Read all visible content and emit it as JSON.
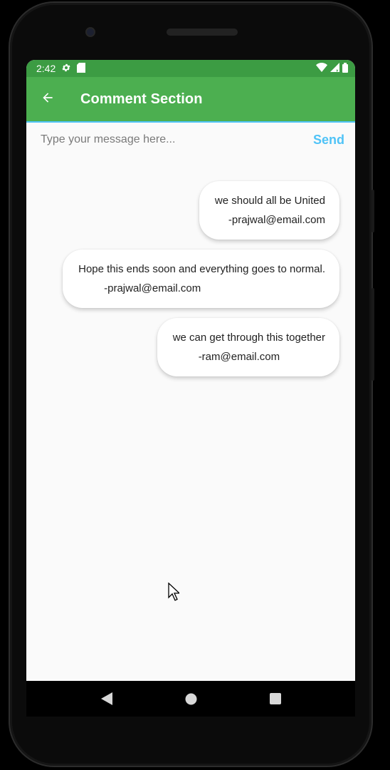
{
  "status_bar": {
    "time": "2:42",
    "icons": [
      "settings-icon",
      "sd-card-icon",
      "wifi-icon",
      "signal-icon",
      "battery-icon"
    ]
  },
  "app_bar": {
    "title": "Comment Section",
    "back_icon": "arrow-back-icon"
  },
  "composer": {
    "placeholder": "Type your message here...",
    "value": "",
    "send_label": "Send"
  },
  "comments": [
    {
      "text": "we should all be United",
      "author": "-prajwal@email.com"
    },
    {
      "text": "Hope this ends soon and everything goes to normal.",
      "author": "-prajwal@email.com"
    },
    {
      "text": "we can get through this together",
      "author": "-ram@email.com"
    }
  ],
  "nav_bar": {
    "icons": [
      "back-triangle-icon",
      "home-circle-icon",
      "recents-square-icon"
    ]
  },
  "colors": {
    "status_bar": "#3c9c43",
    "app_bar": "#4caf50",
    "accent": "#4fc3f7",
    "background": "#fafafa"
  }
}
